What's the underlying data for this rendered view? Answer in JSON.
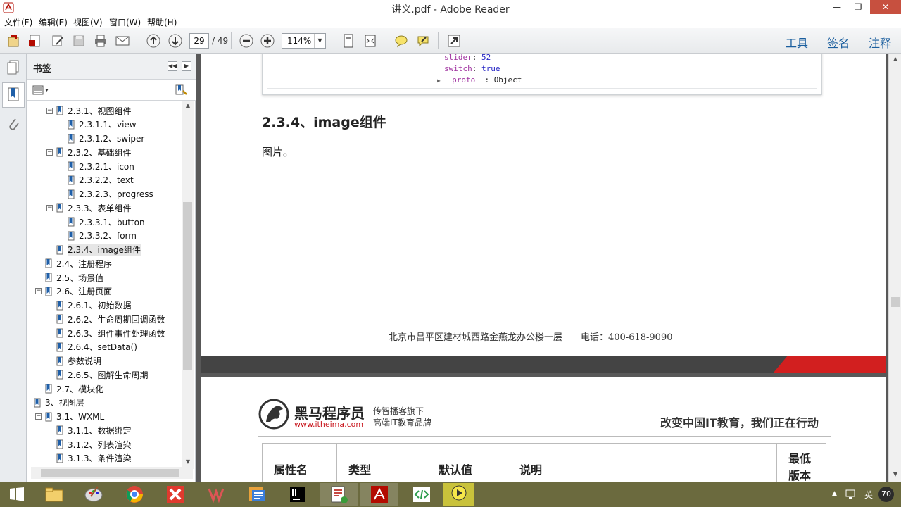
{
  "window": {
    "title": "讲义.pdf - Adobe Reader"
  },
  "menu": [
    "文件(F)",
    "编辑(E)",
    "视图(V)",
    "窗口(W)",
    "帮助(H)"
  ],
  "toolbar": {
    "page_current": "29",
    "page_total": "/ 49",
    "zoom": "114%",
    "right_tabs": [
      "工具",
      "签名",
      "注释"
    ]
  },
  "bookmarks": {
    "title": "书签",
    "items": [
      {
        "label": "2.3.1、视图组件",
        "level": 2,
        "expander": "⊟"
      },
      {
        "label": "2.3.1.1、view",
        "level": 3,
        "expander": ""
      },
      {
        "label": "2.3.1.2、swiper",
        "level": 3,
        "expander": ""
      },
      {
        "label": "2.3.2、基础组件",
        "level": 2,
        "expander": "⊟"
      },
      {
        "label": "2.3.2.1、icon",
        "level": 3,
        "expander": ""
      },
      {
        "label": "2.3.2.2、text",
        "level": 3,
        "expander": ""
      },
      {
        "label": "2.3.2.3、progress",
        "level": 3,
        "expander": ""
      },
      {
        "label": "2.3.3、表单组件",
        "level": 2,
        "expander": "⊟"
      },
      {
        "label": "2.3.3.1、button",
        "level": 3,
        "expander": ""
      },
      {
        "label": "2.3.3.2、form",
        "level": 3,
        "expander": ""
      },
      {
        "label": "2.3.4、image组件",
        "level": 2,
        "expander": "",
        "selected": true
      },
      {
        "label": "2.4、注册程序",
        "level": 1,
        "expander": ""
      },
      {
        "label": "2.5、场景值",
        "level": 1,
        "expander": ""
      },
      {
        "label": "2.6、注册页面",
        "level": 1,
        "expander": "⊟"
      },
      {
        "label": "2.6.1、初始数据",
        "level": 2,
        "expander": ""
      },
      {
        "label": "2.6.2、生命周期回调函数",
        "level": 2,
        "expander": ""
      },
      {
        "label": "2.6.3、组件事件处理函数",
        "level": 2,
        "expander": ""
      },
      {
        "label": "2.6.4、setData()",
        "level": 2,
        "expander": ""
      },
      {
        "label": "参数说明",
        "level": 2,
        "expander": ""
      },
      {
        "label": "2.6.5、图解生命周期",
        "level": 2,
        "expander": ""
      },
      {
        "label": "2.7、模块化",
        "level": 1,
        "expander": ""
      },
      {
        "label": "3、视图层",
        "level": 0,
        "expander": "⊟"
      },
      {
        "label": "3.1、WXML",
        "level": 1,
        "expander": "⊟"
      },
      {
        "label": "3.1.1、数据绑定",
        "level": 2,
        "expander": ""
      },
      {
        "label": "3.1.2、列表渲染",
        "level": 2,
        "expander": ""
      },
      {
        "label": "3.1.3、条件渲染",
        "level": 2,
        "expander": ""
      }
    ]
  },
  "document": {
    "code_lines": [
      {
        "key": "slider",
        "sep": ": ",
        "value": "52"
      },
      {
        "key": "switch",
        "sep": ": ",
        "value": "true"
      },
      {
        "key": "__proto__",
        "sep": ": ",
        "value": "Object",
        "arrow": "▶"
      }
    ],
    "section_heading": "2.3.4、image组件",
    "paragraph": "图片。",
    "footer_address": "北京市昌平区建材城西路金燕龙办公楼一层　　电话：400-618-9090",
    "logo": {
      "brand": "黑马程序员",
      "url": "www.itheima.com",
      "tagline_1": "传智播客旗下",
      "tagline_2": "高端IT教育品牌"
    },
    "slogan": "改变中国IT教育，我们正在行动",
    "table_headers": [
      "属性名",
      "类型",
      "默认值",
      "说明",
      "最低版本"
    ]
  },
  "taskbar": {
    "tray_lang": "英",
    "tray_badge": "70"
  },
  "colors": {
    "accent_blue": "#1a5e9e",
    "band_red": "#d21f1f",
    "taskbar": "#6b6a3e"
  }
}
